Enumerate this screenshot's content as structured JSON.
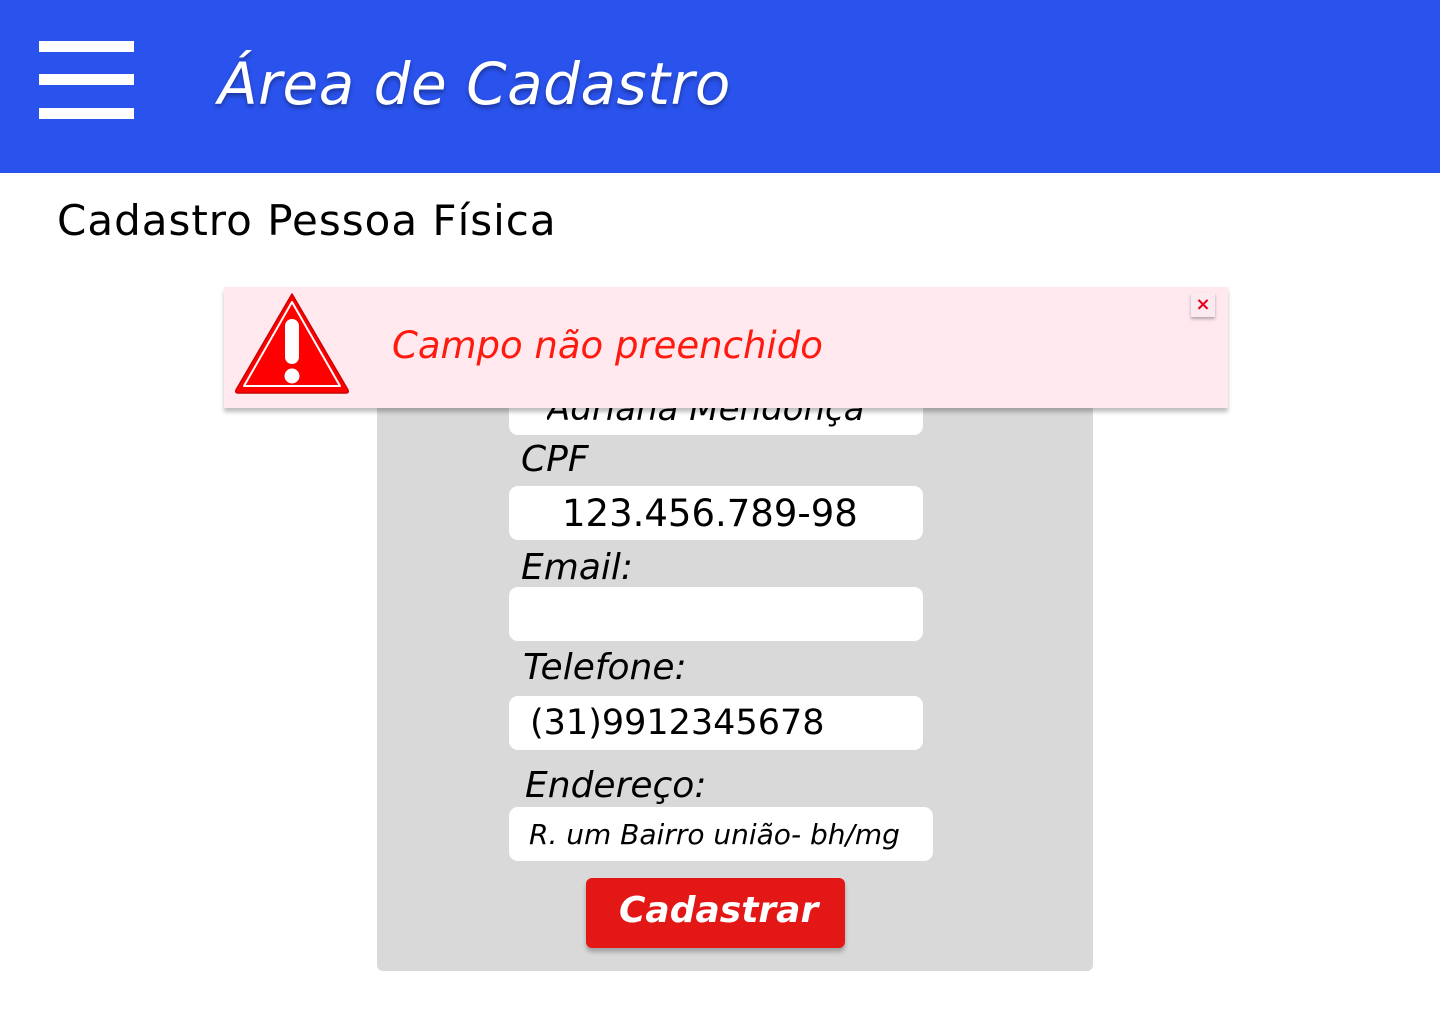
{
  "header": {
    "title": "Área de Cadastro",
    "menu_icon": "hamburger-menu-icon",
    "background_color": "#2a53ee"
  },
  "page": {
    "title": "Cadastro Pessoa Física"
  },
  "form": {
    "name_value": "Adriana Mendonça",
    "cpf_label": "CPF",
    "cpf_value": "123.456.789-98",
    "email_label": "Email:",
    "email_value": "",
    "phone_label": "Telefone:",
    "phone_value": "(31)9912345678",
    "address_label": "Endereço:",
    "address_value": "R. um Bairro união- bh/mg",
    "submit_label": "Cadastrar",
    "submit_color": "#e41717",
    "panel_color": "#d9d9d9"
  },
  "alert": {
    "message": "Campo não preenchido",
    "icon": "warning-triangle-icon",
    "close_icon": "close-icon",
    "close_glyph": "×",
    "background_color": "#ffe8ee",
    "text_color": "#ff1a0f"
  }
}
